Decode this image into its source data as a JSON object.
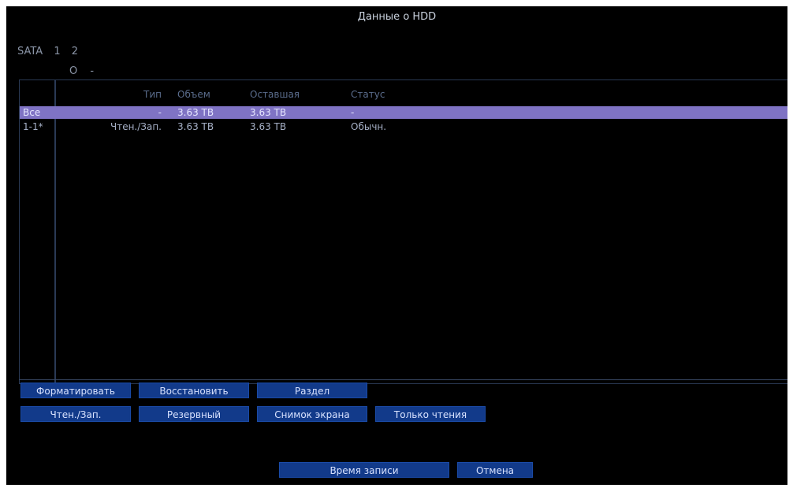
{
  "title": "Данные о HDD",
  "sata": {
    "label": "SATA",
    "ports": [
      "1",
      "2"
    ],
    "status": [
      "O",
      "-"
    ]
  },
  "table": {
    "headers": {
      "type": "Тип",
      "capacity": "Объем",
      "remaining": "Оставшая",
      "status": "Статус"
    },
    "rows": [
      {
        "id": "Все",
        "type": "-",
        "capacity": "3.63 TB",
        "remaining": "3.63 TB",
        "status": "-"
      },
      {
        "id": "1-1*",
        "type": "Чтен./Зап.",
        "capacity": "3.63 TB",
        "remaining": "3.63 TB",
        "status": "Обычн."
      }
    ]
  },
  "buttons": {
    "format": "Форматировать",
    "restore": "Восстановить",
    "partition": "Раздел",
    "read_write": "Чтен./Зап.",
    "backup": "Резервный",
    "snapshot": "Снимок экрана",
    "read_only": "Только чтения",
    "record_time": "Время записи",
    "cancel": "Отмена"
  }
}
